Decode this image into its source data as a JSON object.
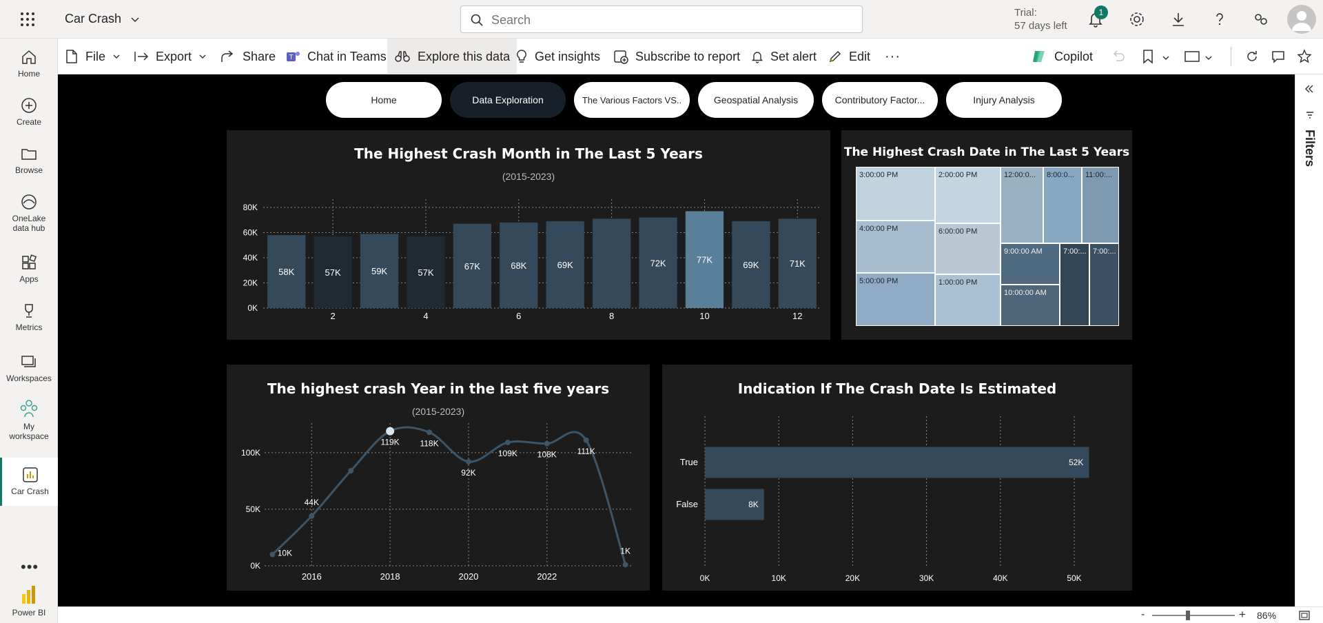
{
  "header": {
    "app_title": "Car Crash",
    "search_placeholder": "Search",
    "trial_line1": "Trial:",
    "trial_line2": "57 days left",
    "notification_count": "1"
  },
  "nav": {
    "items": [
      {
        "label": "Home"
      },
      {
        "label": "Create"
      },
      {
        "label": "Browse"
      },
      {
        "label": "OneLake",
        "label2": "data hub"
      },
      {
        "label": "Apps"
      },
      {
        "label": "Metrics"
      },
      {
        "label": "Workspaces"
      },
      {
        "label": "My",
        "label2": "workspace"
      },
      {
        "label": "Car Crash"
      }
    ],
    "brand": "Power BI"
  },
  "toolbar": {
    "file": "File",
    "export": "Export",
    "share": "Share",
    "chat": "Chat in Teams",
    "explore": "Explore this data",
    "insights": "Get insights",
    "subscribe": "Subscribe to report",
    "alert": "Set alert",
    "edit": "Edit",
    "more": "···",
    "copilot": "Copilot"
  },
  "tabs": [
    {
      "label": "Home",
      "active": false
    },
    {
      "label": "Data Exploration",
      "active": true
    },
    {
      "label": "The Various Factors VS..",
      "active": false
    },
    {
      "label": "Geospatial Analysis",
      "active": false
    },
    {
      "label": "Contributory Factor...",
      "active": false
    },
    {
      "label": "Injury Analysis",
      "active": false
    }
  ],
  "filters_label": "Filters",
  "zoom": {
    "value": "86%",
    "level": 0.86
  },
  "colors": {
    "canvas": "#000000",
    "panel": "#1c1c1c",
    "bar": "#34495a",
    "bar_dark": "#1f2a33",
    "bar_highlight": "#5a7f99",
    "grid": "#8a8a8a",
    "accent": "#117865"
  },
  "treemap": {
    "title": "The Highest Crash Date in The Last 5 Years",
    "cells": [
      {
        "label": "3:00:00 PM",
        "color": "#c1d3df"
      },
      {
        "label": "4:00:00 PM",
        "color": "#a7bed0"
      },
      {
        "label": "5:00:00 PM",
        "color": "#8facc4"
      },
      {
        "label": "2:00:00 PM",
        "color": "#c3d5e0"
      },
      {
        "label": "6:00:00 PM",
        "color": "#b9c8d2"
      },
      {
        "label": "1:00:00 PM",
        "color": "#aac1d4"
      },
      {
        "label": "12:00:0...",
        "color": "#99b2c3"
      },
      {
        "label": "8:00:0...",
        "color": "#87a8c0"
      },
      {
        "label": "11:00:...",
        "color": "#7d9ab0"
      },
      {
        "label": "9:00:00 AM",
        "color": "#4f6a7e"
      },
      {
        "label": "10:00:00 AM",
        "color": "#4e6678"
      },
      {
        "label": "7:00:...",
        "color": "#334656"
      },
      {
        "label": "7:00:...",
        "color": "#3b5062"
      }
    ]
  },
  "chart_data": [
    {
      "type": "bar",
      "title": "The Highest Crash Month in The Last 5 Years",
      "subtitle": "(2015-2023)",
      "categories": [
        1,
        2,
        3,
        4,
        5,
        6,
        7,
        8,
        9,
        10,
        11,
        12
      ],
      "values": [
        58000,
        57000,
        59000,
        57000,
        67000,
        68000,
        69000,
        71000,
        72000,
        77000,
        69000,
        71000
      ],
      "data_labels": [
        "58K",
        "57K",
        "59K",
        "57K",
        "67K",
        "68K",
        "69K",
        "",
        "72K",
        "77K",
        "69K",
        "71K"
      ],
      "x_ticks": [
        2,
        4,
        6,
        8,
        10,
        12
      ],
      "y_ticks": [
        {
          "v": 0,
          "label": "0K"
        },
        {
          "v": 20000,
          "label": "20K"
        },
        {
          "v": 40000,
          "label": "40K"
        },
        {
          "v": 60000,
          "label": "60K"
        },
        {
          "v": 80000,
          "label": "80K"
        }
      ],
      "ylim": [
        0,
        80000
      ],
      "highlight": 10,
      "dark": [
        2,
        4
      ],
      "grid": true
    },
    {
      "type": "line",
      "title": "The highest crash Year in the last five years",
      "subtitle": "(2015-2023)",
      "x": [
        2015,
        2016,
        2017,
        2018,
        2019,
        2020,
        2021,
        2022,
        2023,
        2024
      ],
      "y": [
        10000,
        44000,
        84000,
        119000,
        118000,
        92000,
        109000,
        108000,
        111000,
        1000
      ],
      "data_labels": [
        "10K",
        "44K",
        "",
        "119K",
        "118K",
        "92K",
        "109K",
        "108K",
        "111K",
        "1K"
      ],
      "x_ticks": [
        {
          "v": 2016,
          "label": "2016"
        },
        {
          "v": 2018,
          "label": "2018"
        },
        {
          "v": 2020,
          "label": "2020"
        },
        {
          "v": 2022,
          "label": "2022"
        }
      ],
      "y_ticks": [
        {
          "v": 0,
          "label": "0K"
        },
        {
          "v": 50000,
          "label": "50K"
        },
        {
          "v": 100000,
          "label": "100K"
        }
      ],
      "xlim": [
        2014.8,
        2024.2
      ],
      "ylim": [
        0,
        120000
      ],
      "grid": true
    },
    {
      "type": "bar",
      "orientation": "horizontal",
      "title": "Indication If The Crash Date Is Estimated",
      "categories": [
        "True",
        "False"
      ],
      "values": [
        52000,
        8000
      ],
      "data_labels": [
        "52K",
        "8K"
      ],
      "x_ticks": [
        {
          "v": 0,
          "label": "0K"
        },
        {
          "v": 10000,
          "label": "10K"
        },
        {
          "v": 20000,
          "label": "20K"
        },
        {
          "v": 30000,
          "label": "30K"
        },
        {
          "v": 40000,
          "label": "40K"
        },
        {
          "v": 50000,
          "label": "50K"
        }
      ],
      "xlim": [
        0,
        50000
      ],
      "grid": true
    }
  ]
}
